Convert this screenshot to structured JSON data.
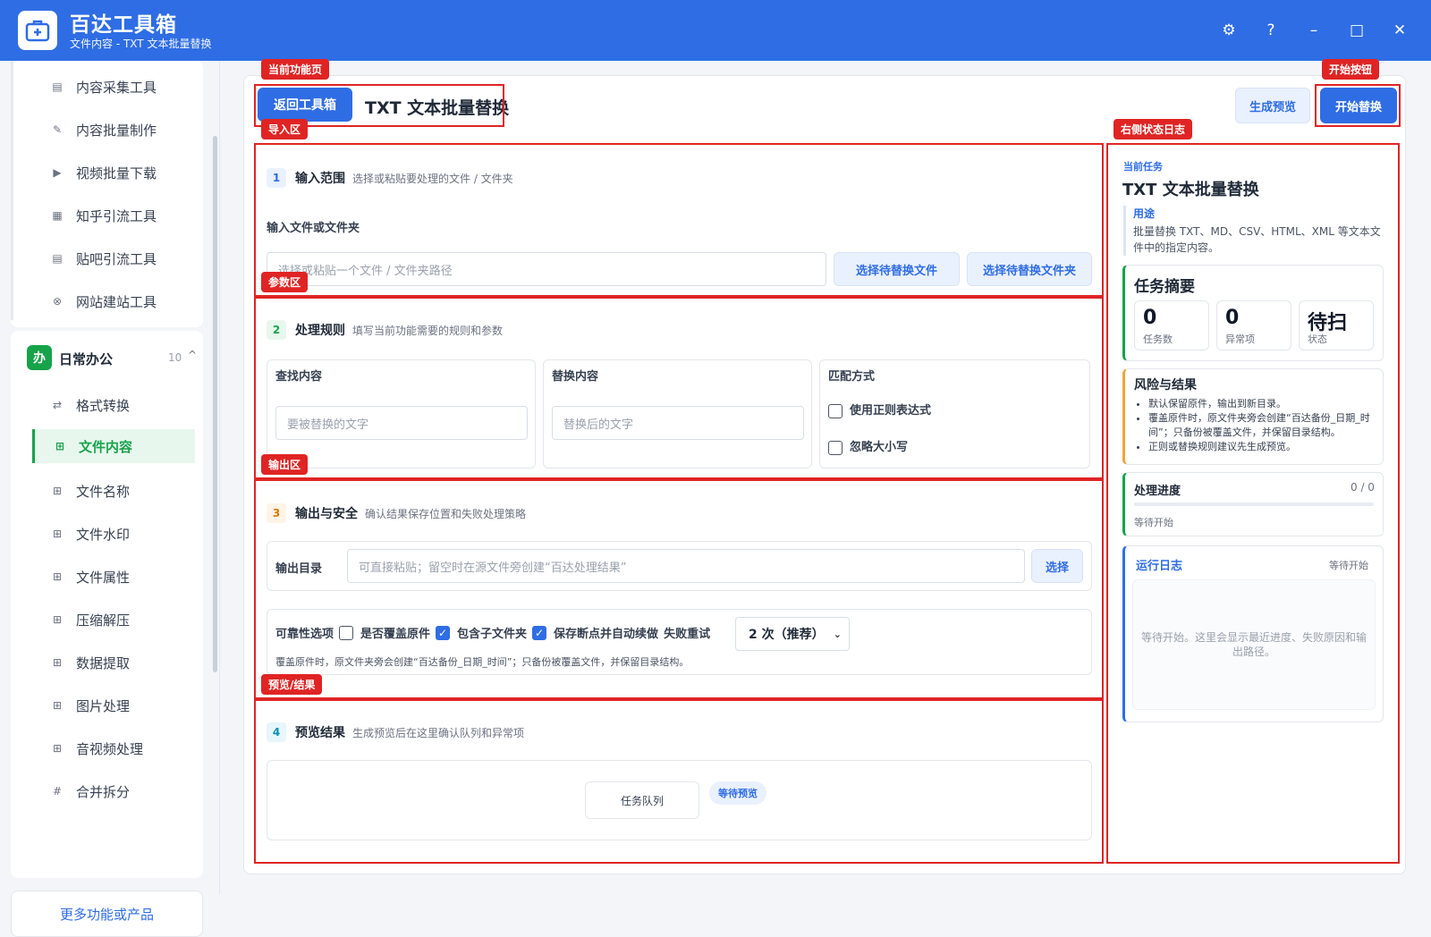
{
  "app": {
    "title": "百达工具箱",
    "subtitle": "文件内容 - TXT 文本批量替换"
  },
  "window": {
    "settings_icon": "⚙",
    "help_icon": "?",
    "minimize_icon": "–",
    "maximize_icon": "□",
    "close_icon": "✕"
  },
  "sidebar": {
    "top_items": [
      {
        "label": "内容采集工具",
        "icon": "▤"
      },
      {
        "label": "内容批量制作",
        "icon": "✎"
      },
      {
        "label": "视频批量下载",
        "icon": "▶"
      },
      {
        "label": "知乎引流工具",
        "icon": "▦"
      },
      {
        "label": "贴吧引流工具",
        "icon": "▤"
      },
      {
        "label": "网站建站工具",
        "icon": "⊗"
      }
    ],
    "group": {
      "badge": "办",
      "name": "日常办公",
      "count": "10",
      "toggle": "^"
    },
    "group_items": [
      {
        "label": "格式转换",
        "icon": "⇄"
      },
      {
        "label": "文件内容",
        "icon": "⊞",
        "active": true
      },
      {
        "label": "文件名称",
        "icon": "⊞"
      },
      {
        "label": "文件水印",
        "icon": "⊞"
      },
      {
        "label": "文件属性",
        "icon": "⊞"
      },
      {
        "label": "压缩解压",
        "icon": "⊞"
      },
      {
        "label": "数据提取",
        "icon": "⊞"
      },
      {
        "label": "图片处理",
        "icon": "⊞"
      },
      {
        "label": "音视频处理",
        "icon": "⊞"
      },
      {
        "label": "合并拆分",
        "icon": "#"
      }
    ],
    "more": "更多功能或产品"
  },
  "header": {
    "back": "返回工具箱",
    "title": "TXT 文本批量替换",
    "preview_btn": "生成预览",
    "start_btn": "开始替换"
  },
  "sections": {
    "s1": {
      "num": "1",
      "title": "输入范围",
      "desc": "选择或粘贴要处理的文件 / 文件夹",
      "field_label": "输入文件或文件夹",
      "placeholder": "选择或粘贴一个文件 / 文件夹路径",
      "btn_file": "选择待替换文件",
      "btn_folder": "选择待替换文件夹"
    },
    "s2": {
      "num": "2",
      "title": "处理规则",
      "desc": "填写当前功能需要的规则和参数",
      "find_label": "查找内容",
      "find_ph": "要被替换的文字",
      "replace_label": "替换内容",
      "replace_ph": "替换后的文字",
      "match_label": "匹配方式",
      "opt_regex": "使用正则表达式",
      "opt_case": "忽略大小写"
    },
    "s3": {
      "num": "3",
      "title": "输出与安全",
      "desc": "确认结果保存位置和失败处理策略",
      "out_label": "输出目录",
      "out_ph": "可直接粘贴；留空时在源文件旁创建“百达处理结果”",
      "choose": "选择",
      "rel_label": "可靠性选项",
      "opt_overwrite": "是否覆盖原件",
      "opt_subfolder": "包含子文件夹",
      "opt_resume": "保存断点并自动续做",
      "retry_label": "失败重试",
      "retry_value": "2 次（推荐）",
      "note": "覆盖原件时，原文件夹旁会创建“百达备份_日期_时间”；只备份被覆盖文件，并保留目录结构。"
    },
    "s4": {
      "num": "4",
      "title": "预览结果",
      "desc": "生成预览后在这里确认队列和异常项",
      "queue": "任务队列",
      "badge": "等待预览"
    }
  },
  "right": {
    "task_label": "当前任务",
    "task_title": "TXT 文本批量替换",
    "use_label": "用途",
    "use_text": "批量替换 TXT、MD、CSV、HTML、XML 等文本文件中的指定内容。",
    "summary_title": "任务摘要",
    "stats": [
      {
        "v": "0",
        "k": "任务数"
      },
      {
        "v": "0",
        "k": "异常项"
      },
      {
        "v": "待扫",
        "k": "状态"
      }
    ],
    "risk_title": "风险与结果",
    "risk_items": [
      "默认保留原件，输出到新目录。",
      "覆盖原件时，原文件夹旁会创建“百达备份_日期_时间”；只备份被覆盖文件，并保留目录结构。",
      "正则或替换规则建议先生成预览。"
    ],
    "progress_title": "处理进度",
    "progress_count": "0 / 0",
    "progress_value": 0,
    "progress_status": "等待开始",
    "log_title": "运行日志",
    "log_status": "等待开始",
    "log_text": "等待开始。这里会显示最近进度、失败原因和输出路径。"
  },
  "annotations": {
    "current_page": "当前功能页",
    "start_button": "开始按钮",
    "import": "导入区",
    "params": "参数区",
    "output": "输出区",
    "preview": "预览/结果",
    "right_log": "右侧状态日志"
  }
}
